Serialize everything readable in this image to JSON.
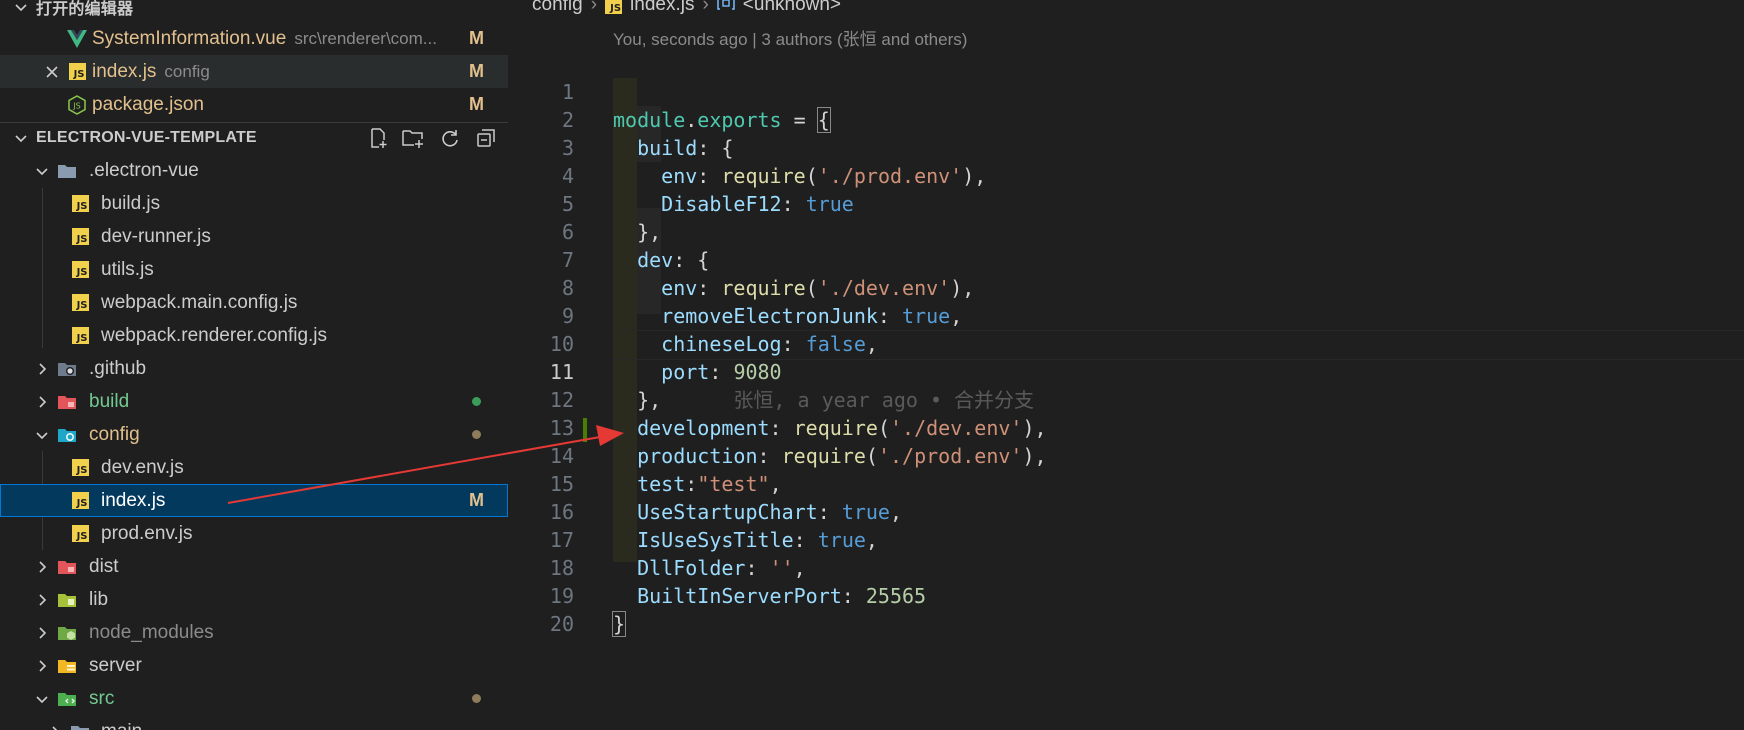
{
  "open_editors": {
    "title": "打开的编辑器",
    "items": [
      {
        "name": "SystemInformation.vue",
        "desc": "src\\renderer\\com...",
        "status": "M"
      },
      {
        "name": "index.js",
        "desc": "config",
        "status": "M"
      },
      {
        "name": "package.json",
        "desc": "",
        "status": "M"
      }
    ]
  },
  "explorer": {
    "project_title": "ELECTRON-VUE-TEMPLATE",
    "tree": [
      {
        "label": ".electron-vue"
      },
      {
        "label": "build.js"
      },
      {
        "label": "dev-runner.js"
      },
      {
        "label": "utils.js"
      },
      {
        "label": "webpack.main.config.js"
      },
      {
        "label": "webpack.renderer.config.js"
      },
      {
        "label": ".github"
      },
      {
        "label": "build"
      },
      {
        "label": "config"
      },
      {
        "label": "dev.env.js"
      },
      {
        "label": "index.js",
        "status": "M"
      },
      {
        "label": "prod.env.js"
      },
      {
        "label": "dist"
      },
      {
        "label": "lib"
      },
      {
        "label": "node_modules"
      },
      {
        "label": "server"
      },
      {
        "label": "src"
      },
      {
        "label": "main"
      }
    ]
  },
  "icons": {
    "new_file": "new-file-icon",
    "new_folder": "new-folder-icon",
    "refresh": "refresh-icon",
    "collapse": "collapse-all-icon",
    "close": "close-icon",
    "vue": "vue-file-icon",
    "js": "js-file-icon",
    "node": "node-package-icon"
  },
  "colors": {
    "accent": "#0078d4",
    "modified": "#e2c08d",
    "added_dot": "#3a9e5a",
    "arrow": "#e53935"
  },
  "breadcrumb": {
    "folder": "config",
    "file": "index.js",
    "symbol": "<unknown>"
  },
  "codelens": "You, seconds ago | 3 authors (张恒 and others)",
  "code": {
    "line_numbers": [
      "1",
      "2",
      "3",
      "4",
      "5",
      "6",
      "7",
      "8",
      "9",
      "10",
      "11",
      "12",
      "13",
      "14",
      "15",
      "16",
      "17",
      "18",
      "19",
      "20"
    ],
    "inline_blame": "张恒, a year ago • 合并分支"
  }
}
